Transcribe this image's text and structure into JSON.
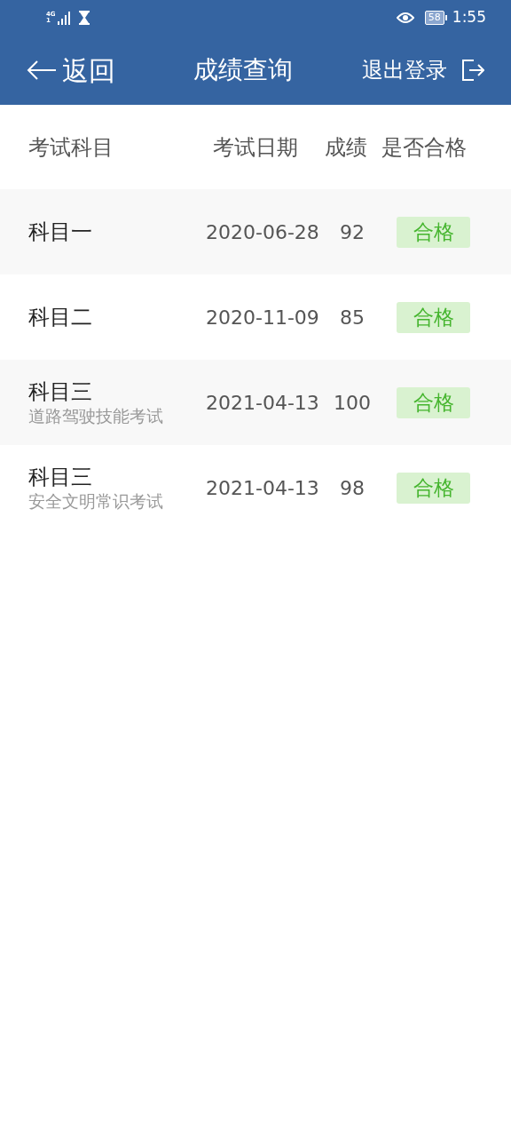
{
  "status_bar": {
    "network": "4G",
    "sim": "1",
    "battery": "58",
    "time": "1:55"
  },
  "header": {
    "back": "返回",
    "title": "成绩查询",
    "logout": "退出登录"
  },
  "table": {
    "columns": [
      "考试科目",
      "考试日期",
      "成绩",
      "是否合格"
    ],
    "rows": [
      {
        "subject": "科目一",
        "date": "2020-06-28",
        "score": "92",
        "result": "合格",
        "passed": true
      },
      {
        "subject": "科目二",
        "date": "2020-11-09",
        "score": "85",
        "result": "合格",
        "passed": true
      },
      {
        "subject": "科目三",
        "detail": "道路驾驶技能考试",
        "date": "2021-04-13",
        "score": "100",
        "result": "合格",
        "passed": true
      },
      {
        "subject": "科目三",
        "detail": "安全文明常识考试",
        "date": "2021-04-13",
        "score": "98",
        "result": "合格",
        "passed": true
      }
    ]
  }
}
